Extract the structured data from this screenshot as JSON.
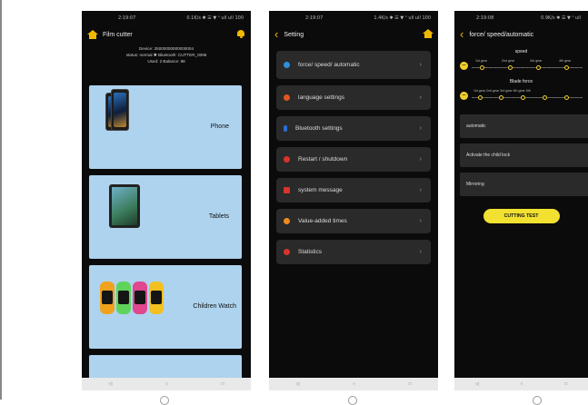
{
  "screen1": {
    "status_time": "2:19:07",
    "status_icons": "0.1K/s ✱ ☰ ▼ ⁿ ull ull 100",
    "title": "Film cutter",
    "device_line": "Device: 25000000000000004",
    "status_line": "status: normal  ✱ Bluetooth: CUTTER_0086",
    "stats_line": "Used: 2  Balance: 98",
    "devices": [
      {
        "label": "Phone"
      },
      {
        "label": "Tablets"
      },
      {
        "label": "Children Watch"
      }
    ]
  },
  "screen2": {
    "status_time": "2:19:07",
    "status_icons": "1.4K/s ✱ ☰ ▼ ⁿ ull ull 100",
    "title": "Setting",
    "items": [
      {
        "label": "force/ speed/ automatic",
        "color": "#2f8fd8"
      },
      {
        "label": "language settings",
        "color": "#e0561f"
      },
      {
        "label": "Bluetooth settings",
        "color": "#2a6fd6"
      },
      {
        "label": "Restart / shutdown",
        "color": "#d8352a"
      },
      {
        "label": "system message",
        "color": "#d8352a"
      },
      {
        "label": "Value-added times",
        "color": "#ef8a1d"
      },
      {
        "label": "Statistics",
        "color": "#d8352a"
      }
    ]
  },
  "screen3": {
    "status_time": "2:19:08",
    "status_icons": "0.9K/s ✱ ☰ ▼ ⁿ ull",
    "title": "force/ speed/automatic",
    "speed_label": "speed",
    "speed_ticks": [
      "1st gear",
      "2nd gear",
      "3rd gear",
      "4th gear"
    ],
    "force_label": "Blade force",
    "force_ticks": [
      "1st gear 2nd gear 3rd gear 4th gear 5th"
    ],
    "options": [
      "automatic",
      "Activate the child lock",
      "Mirroring"
    ],
    "button": "CUTTING TEST"
  },
  "nav": {
    "back": "◁",
    "home": "○",
    "recent": "□"
  },
  "colors": {
    "card": "#aed3ee",
    "accent": "#f0b800",
    "button": "#f2e130"
  }
}
